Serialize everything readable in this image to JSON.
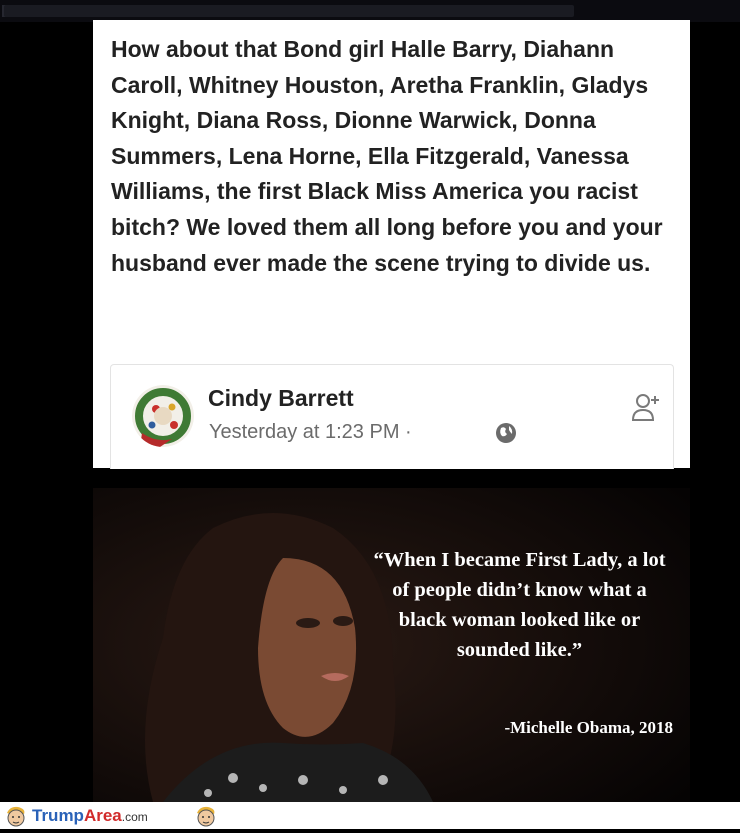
{
  "post": {
    "text": "How about that Bond girl Halle Barry, Diahann Caroll, Whitney Houston, Aretha Franklin, Gladys Knight, Diana Ross, Dionne Warwick, Donna Summers, Lena Horne, Ella Fitzgerald, Vanessa Williams, the first Black Miss America you racist bitch? We loved them all long before you and your husband ever made the scene trying to divide us.",
    "author": "Cindy Barrett",
    "timestamp": "Yesterday at 1:23 PM ·",
    "privacy_icon": "globe-icon",
    "add_friend_icon": "add-friend-icon"
  },
  "quote": {
    "text": "“When I became First Lady, a lot of people didn’t know what a black woman looked like or sounded like.”",
    "attribution": "-Michelle Obama, 2018"
  },
  "footer": {
    "brand_part1": "Trump",
    "brand_part2": "Area",
    "brand_part3": ".com",
    "mascot_icon": "caricature-icon",
    "colors": {
      "brand_blue": "#2a62b8",
      "brand_red": "#d12b2b"
    }
  }
}
